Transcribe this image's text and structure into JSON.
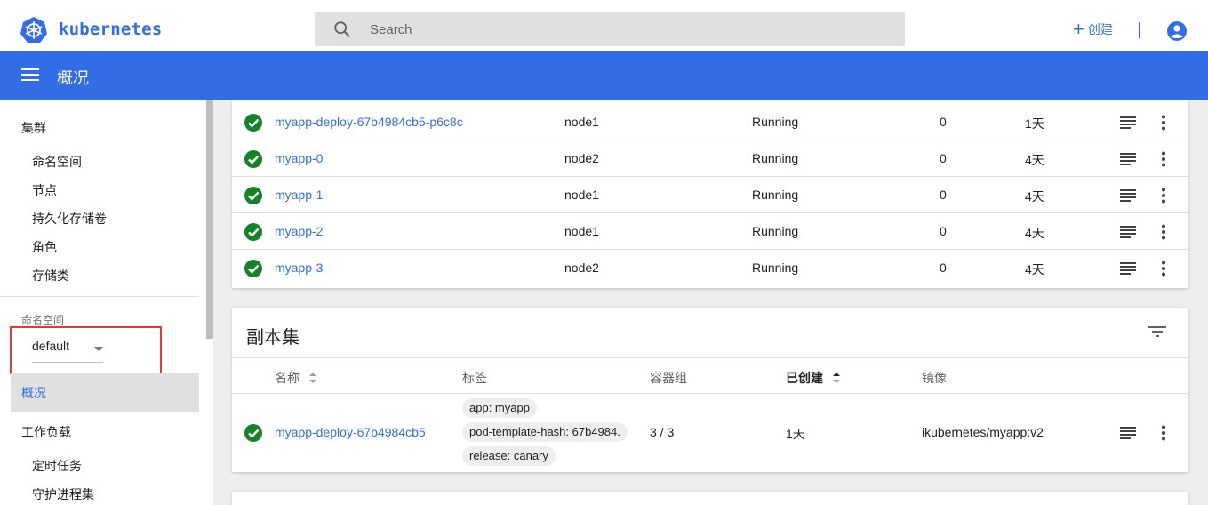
{
  "app": {
    "brand": "kubernetes",
    "page_title": "概况"
  },
  "search": {
    "placeholder": "Search"
  },
  "header": {
    "create_label": "创建"
  },
  "colors": {
    "primary": "#326de6",
    "success": "#158227",
    "highlight": "#e53935"
  },
  "sidebar": {
    "cluster_label": "集群",
    "cluster_items": [
      "命名空间",
      "节点",
      "持久化存储卷",
      "角色",
      "存储类"
    ],
    "namespace_label": "命名空间",
    "namespace_value": "default",
    "overview_label": "概况",
    "workloads_label": "工作负载",
    "workload_items": [
      "定时任务",
      "守护进程集"
    ]
  },
  "pods": [
    {
      "name": "myapp-deploy-67b4984cb5-p6c8c",
      "node": "node1",
      "status": "Running",
      "restarts": "0",
      "age": "1天"
    },
    {
      "name": "myapp-0",
      "node": "node2",
      "status": "Running",
      "restarts": "0",
      "age": "4天"
    },
    {
      "name": "myapp-1",
      "node": "node1",
      "status": "Running",
      "restarts": "0",
      "age": "4天"
    },
    {
      "name": "myapp-2",
      "node": "node1",
      "status": "Running",
      "restarts": "0",
      "age": "4天"
    },
    {
      "name": "myapp-3",
      "node": "node2",
      "status": "Running",
      "restarts": "0",
      "age": "4天"
    }
  ],
  "replicasets": {
    "title": "副本集",
    "columns": {
      "name": "名称",
      "labels": "标签",
      "pods": "容器组",
      "created": "已创建",
      "images": "镜像"
    },
    "rows": [
      {
        "name": "myapp-deploy-67b4984cb5",
        "labels": [
          "app: myapp",
          "pod-template-hash: 67b4984.",
          "release: canary"
        ],
        "pods": "3 / 3",
        "created": "1天",
        "image": "ikubernetes/myapp:v2"
      }
    ]
  }
}
